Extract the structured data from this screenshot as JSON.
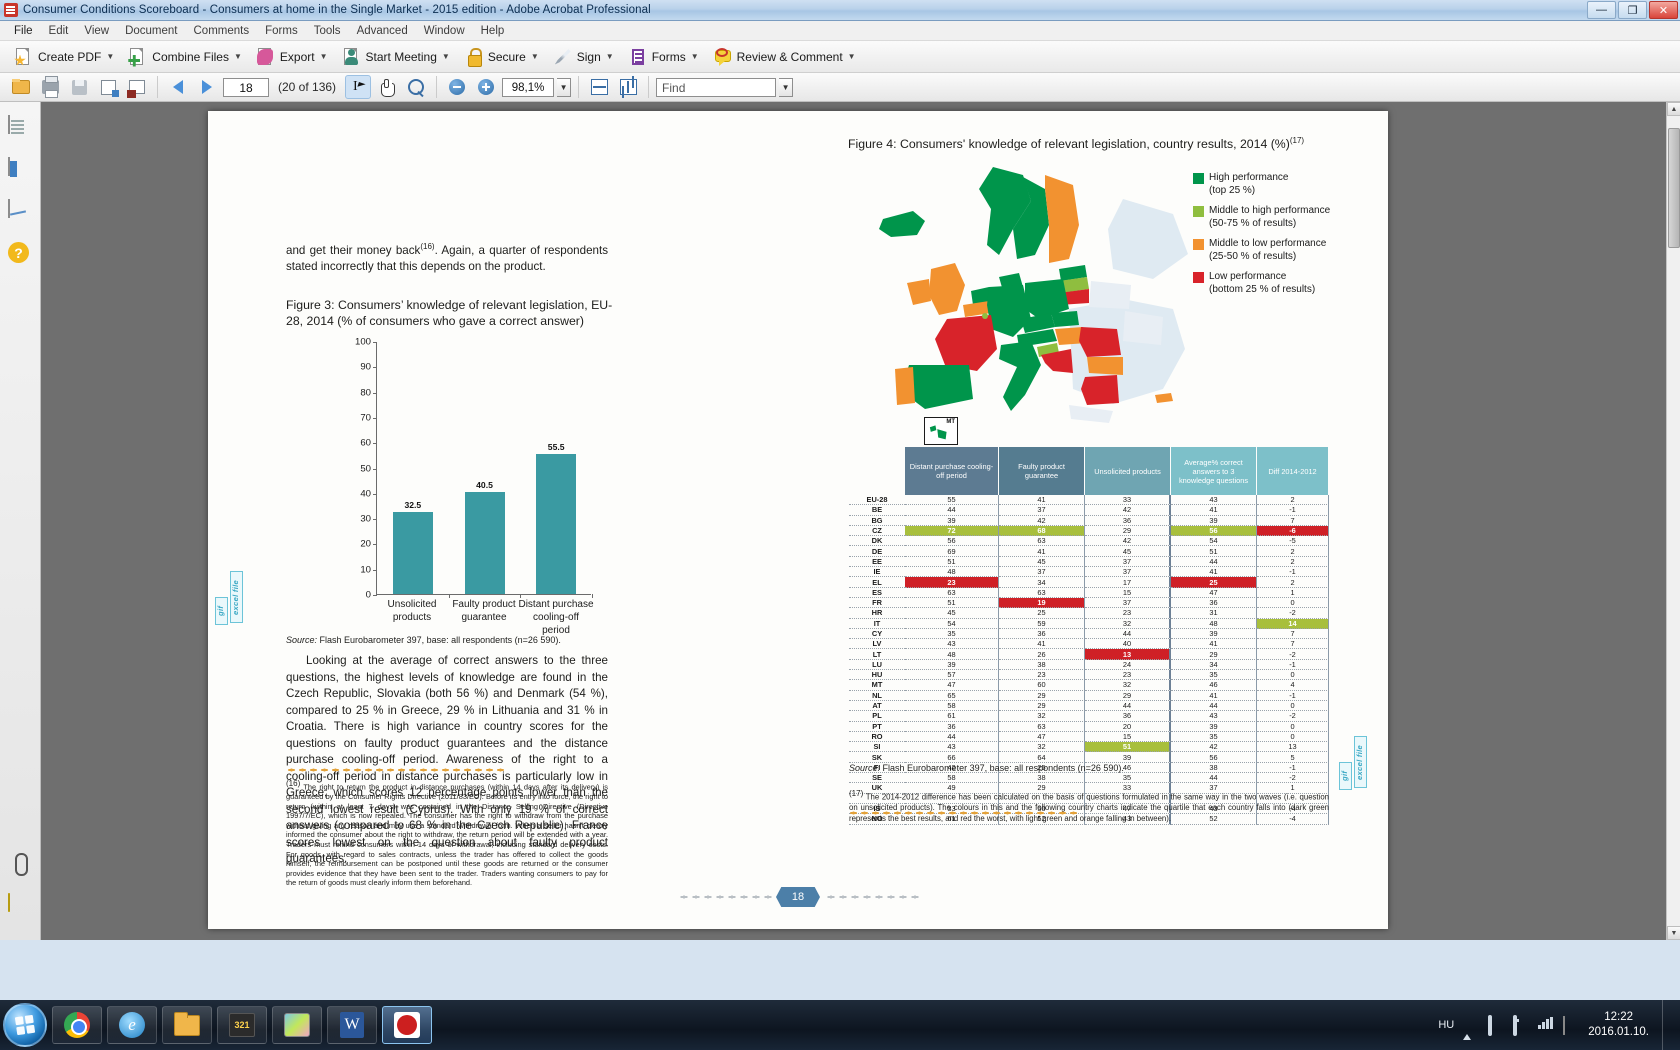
{
  "window": {
    "title": "Consumer Conditions Scoreboard - Consumers at home in the Single Market - 2015 edition - Adobe Acrobat Professional",
    "minimize": "—",
    "maximize": "❐",
    "close": "✕"
  },
  "menu": [
    "File",
    "Edit",
    "View",
    "Document",
    "Comments",
    "Forms",
    "Tools",
    "Advanced",
    "Window",
    "Help"
  ],
  "toolbar1": [
    {
      "label": "Create PDF",
      "icon": "create-pdf-icon"
    },
    {
      "label": "Combine Files",
      "icon": "combine-files-icon"
    },
    {
      "label": "Export",
      "icon": "export-icon"
    },
    {
      "label": "Start Meeting",
      "icon": "start-meeting-icon"
    },
    {
      "label": "Secure",
      "icon": "secure-lock-icon"
    },
    {
      "label": "Sign",
      "icon": "sign-pen-icon"
    },
    {
      "label": "Forms",
      "icon": "forms-icon"
    },
    {
      "label": "Review & Comment",
      "icon": "review-comment-icon"
    }
  ],
  "toolbar2": {
    "open_label": "Open",
    "print_label": "Print",
    "save_label": "Save",
    "page_value": "18",
    "page_count": "(20 of 136)",
    "zoom_value": "98,1%",
    "find_placeholder": "Find",
    "zoom_out_label": "−",
    "zoom_in_label": "+"
  },
  "page": {
    "body": {
      "para1_pre": "and get their money back",
      "para1_sup": "(16)",
      "para1_post": ". Again, a quarter of respondents stated incorrectly that this depends on the product.",
      "para2": "Looking at the average of correct answers to the three questions, the highest levels of knowledge are found in the Czech Republic, Slovakia (both 56 %) and Denmark (54 %), compared to 25 % in Greece, 29 % in Lithuania and 31 % in Croatia. There is high variance in country scores for the questions on faulty product guarantees and the distance purchase cooling-off period. Awareness of the right to a cooling-off period in distance purchases is particularly low in Greece, which scores 12 percentage points lower than the second lowest result (Cyprus). With only 19 % of correct answers (compared to 68 % in the Czech Republic), France scores lowest on the question about faulty product guarantees."
    },
    "footnote16": {
      "marker": "(16)",
      "text": "The right to return the product in distance purchases (within 14 days after its delivery) is guaranteed by the Consumer Rights Directive (2011/83/EC). Before its entry into force, the right to return (within at least 7 days) was contained in the Distance Selling Directive (Directive 1997/7/EC), which is now repealed. The consumer has the right to withdraw from the purchase without giving any reason and may use a standard withdrawal form. When a seller hasn't clearly informed the consumer about the right to withdraw, the return period will be extended with a year. Traders must refund consumers within 14 days of withdrawal, including standard delivery costs. For goods, with regard to sales contracts, unless the trader has offered to collect the goods himself, the reimbursement can be postponed until these goods are returned or the consumer provides evidence that they have been sent to the trader. Traders wanting consumers to pay for the return of goods must clearly inform them beforehand."
    },
    "footnote17": {
      "marker": "(17)",
      "text": "The 2014-2012 difference has been calculated on the basis of questions formulated in the same way in the two waves (i.e. question on unsolicited products). The colours in this and the following country charts indicate the quartile that each country falls into (dark green represents the best results, and red the worst, with light green and orange falling in between)."
    },
    "excel_tab_label": "excel file",
    "gif_tab_label": "gif",
    "page_number": "18"
  },
  "figure3": {
    "title": "Figure 3: Consumers’ knowledge of relevant legislation, EU-28, 2014 (% of consumers who gave a correct answer)",
    "source_label": "Source:",
    "source_text": " Flash Eurobarometer 397, base: all respondents (n=26 590)."
  },
  "figure4": {
    "title_main": "Figure 4: Consumers' knowledge of relevant legislation, country results, 2014 (%)",
    "title_sup": "(17)",
    "map_inset_label": "MT",
    "source_label": "Source:",
    "source_text": " Flash Eurobarometer 397, base: all respondents (n=26 590).",
    "legend": [
      {
        "color": "#00954b",
        "line1": "High performance",
        "line2": "(top 25 %)"
      },
      {
        "color": "#8fbe3f",
        "line1": "Middle to high performance",
        "line2": "(50-75 % of results)"
      },
      {
        "color": "#f29230",
        "line1": "Middle to low performance",
        "line2": "(25-50 % of results)"
      },
      {
        "color": "#d8232a",
        "line1": "Low performance",
        "line2": "(bottom 25 % of results)"
      }
    ],
    "table": {
      "headers": [
        "",
        "Distant purchase cooling-off period",
        "Faulty product guarantee",
        "Unsolicited products",
        "Average% correct answers to 3 knowledge questions",
        "Diff 2014-2012"
      ],
      "rows": [
        {
          "c": "EU-28",
          "v": [
            "55",
            "41",
            "33",
            "43",
            "2"
          ],
          "h": [
            "",
            "",
            "",
            "",
            ""
          ]
        },
        {
          "c": "BE",
          "v": [
            "44",
            "37",
            "42",
            "41",
            "-1"
          ],
          "h": [
            "",
            "",
            "",
            "",
            ""
          ]
        },
        {
          "c": "BG",
          "v": [
            "39",
            "42",
            "36",
            "39",
            "7"
          ],
          "h": [
            "",
            "",
            "",
            "",
            ""
          ]
        },
        {
          "c": "CZ",
          "v": [
            "72",
            "68",
            "29",
            "56",
            "-6"
          ],
          "h": [
            "green",
            "green",
            "",
            "green",
            "red"
          ]
        },
        {
          "c": "DK",
          "v": [
            "56",
            "63",
            "42",
            "54",
            "-5"
          ],
          "h": [
            "",
            "",
            "",
            "",
            ""
          ]
        },
        {
          "c": "DE",
          "v": [
            "69",
            "41",
            "45",
            "51",
            "2"
          ],
          "h": [
            "",
            "",
            "",
            "",
            ""
          ]
        },
        {
          "c": "EE",
          "v": [
            "51",
            "45",
            "37",
            "44",
            "2"
          ],
          "h": [
            "",
            "",
            "",
            "",
            ""
          ]
        },
        {
          "c": "IE",
          "v": [
            "48",
            "37",
            "37",
            "41",
            "-1"
          ],
          "h": [
            "",
            "",
            "",
            "",
            ""
          ]
        },
        {
          "c": "EL",
          "v": [
            "23",
            "34",
            "17",
            "25",
            "2"
          ],
          "h": [
            "red",
            "",
            "",
            "red",
            ""
          ]
        },
        {
          "c": "ES",
          "v": [
            "63",
            "63",
            "15",
            "47",
            "1"
          ],
          "h": [
            "",
            "",
            "",
            "",
            ""
          ]
        },
        {
          "c": "FR",
          "v": [
            "51",
            "19",
            "37",
            "36",
            "0"
          ],
          "h": [
            "",
            "red",
            "",
            "",
            ""
          ]
        },
        {
          "c": "HR",
          "v": [
            "45",
            "25",
            "23",
            "31",
            "-2"
          ],
          "h": [
            "",
            "",
            "",
            "",
            ""
          ]
        },
        {
          "c": "IT",
          "v": [
            "54",
            "59",
            "32",
            "48",
            "14"
          ],
          "h": [
            "",
            "",
            "",
            "",
            "green"
          ]
        },
        {
          "c": "CY",
          "v": [
            "35",
            "36",
            "44",
            "39",
            "7"
          ],
          "h": [
            "",
            "",
            "",
            "",
            ""
          ]
        },
        {
          "c": "LV",
          "v": [
            "43",
            "41",
            "40",
            "41",
            "7"
          ],
          "h": [
            "",
            "",
            "",
            "",
            ""
          ]
        },
        {
          "c": "LT",
          "v": [
            "48",
            "26",
            "13",
            "29",
            "-2"
          ],
          "h": [
            "",
            "",
            "red",
            "",
            ""
          ]
        },
        {
          "c": "LU",
          "v": [
            "39",
            "38",
            "24",
            "34",
            "-1"
          ],
          "h": [
            "",
            "",
            "",
            "",
            ""
          ]
        },
        {
          "c": "HU",
          "v": [
            "57",
            "23",
            "23",
            "35",
            "0"
          ],
          "h": [
            "",
            "",
            "",
            "",
            ""
          ]
        },
        {
          "c": "MT",
          "v": [
            "47",
            "60",
            "32",
            "46",
            "4"
          ],
          "h": [
            "",
            "",
            "",
            "",
            ""
          ]
        },
        {
          "c": "NL",
          "v": [
            "65",
            "29",
            "29",
            "41",
            "-1"
          ],
          "h": [
            "",
            "",
            "",
            "",
            ""
          ]
        },
        {
          "c": "AT",
          "v": [
            "58",
            "29",
            "44",
            "44",
            "0"
          ],
          "h": [
            "",
            "",
            "",
            "",
            ""
          ]
        },
        {
          "c": "PL",
          "v": [
            "61",
            "32",
            "36",
            "43",
            "-2"
          ],
          "h": [
            "",
            "",
            "",
            "",
            ""
          ]
        },
        {
          "c": "PT",
          "v": [
            "36",
            "63",
            "20",
            "39",
            "0"
          ],
          "h": [
            "",
            "",
            "",
            "",
            ""
          ]
        },
        {
          "c": "RO",
          "v": [
            "44",
            "47",
            "15",
            "35",
            "0"
          ],
          "h": [
            "",
            "",
            "",
            "",
            ""
          ]
        },
        {
          "c": "SI",
          "v": [
            "43",
            "32",
            "51",
            "42",
            "13"
          ],
          "h": [
            "",
            "",
            "green",
            "",
            ""
          ]
        },
        {
          "c": "SK",
          "v": [
            "66",
            "64",
            "39",
            "56",
            "5"
          ],
          "h": [
            "",
            "",
            "",
            "",
            ""
          ]
        },
        {
          "c": "FI",
          "v": [
            "42",
            "25",
            "46",
            "38",
            "-1"
          ],
          "h": [
            "",
            "",
            "",
            "",
            ""
          ]
        },
        {
          "c": "SE",
          "v": [
            "58",
            "38",
            "35",
            "44",
            "-2"
          ],
          "h": [
            "",
            "",
            "",
            "",
            ""
          ]
        },
        {
          "c": "UK",
          "v": [
            "49",
            "29",
            "33",
            "37",
            "1"
          ],
          "h": [
            "",
            "",
            "",
            "",
            ""
          ]
        },
        {
          "c": "",
          "v": [
            "",
            "",
            "",
            "",
            ""
          ],
          "h": [
            "",
            "",
            "",
            "",
            ""
          ]
        },
        {
          "c": "IS",
          "v": [
            "33",
            "50",
            "47",
            "43",
            "-4"
          ],
          "h": [
            "",
            "",
            "",
            "",
            ""
          ]
        },
        {
          "c": "NO",
          "v": [
            "61",
            "52",
            "43",
            "52",
            "-4"
          ],
          "h": [
            "",
            "",
            "",
            "",
            ""
          ]
        }
      ]
    }
  },
  "chart_data": {
    "type": "bar",
    "title": "Figure 3: Consumers’ knowledge of relevant legislation, EU-28, 2014 (% of consumers who gave a correct answer)",
    "categories": [
      "Unsolicited products",
      "Faulty product guarantee",
      "Distant purchase cooling-off period"
    ],
    "values": [
      32.5,
      40.5,
      55.5
    ],
    "data_labels": [
      "32.5",
      "40.5",
      "55.5"
    ],
    "xlabel": "",
    "ylabel": "",
    "ylim": [
      0,
      100
    ],
    "yticks": [
      0,
      10,
      20,
      30,
      40,
      50,
      60,
      70,
      80,
      90,
      100
    ],
    "ytick_labels": [
      "0",
      "10",
      "20",
      "30",
      "40",
      "50",
      "60",
      "70",
      "80",
      "90",
      "100"
    ],
    "series_color": "#3a9aa2",
    "grid": false,
    "legend": "none"
  },
  "taskbar": {
    "lang": "HU",
    "time": "12:22",
    "date": "2016.01.10.",
    "items": [
      "chrome",
      "internet-explorer",
      "file-explorer",
      "total-commander",
      "paint",
      "word",
      "acrobat"
    ]
  }
}
